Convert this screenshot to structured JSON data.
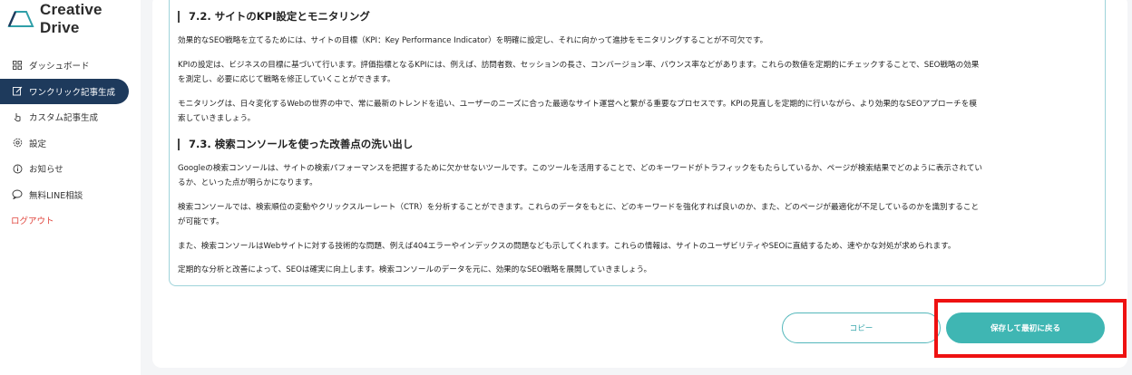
{
  "app": {
    "logo_text": "Creative Drive"
  },
  "sidebar": {
    "items": [
      {
        "label": "ダッシュボード",
        "icon": "grid-icon"
      },
      {
        "label": "ワンクリック記事生成",
        "icon": "edit-icon"
      },
      {
        "label": "カスタム記事生成",
        "icon": "pointer-icon"
      },
      {
        "label": "設定",
        "icon": "gear-icon"
      },
      {
        "label": "お知らせ",
        "icon": "info-icon"
      },
      {
        "label": "無料LINE相談",
        "icon": "chat-icon"
      },
      {
        "label": "ログアウト",
        "icon": ""
      }
    ],
    "active_index": 1
  },
  "article": {
    "section1_title": "7.2. サイトのKPI設定とモニタリング",
    "section1_p1": "効果的なSEO戦略を立てるためには、サイトの目標（KPI：Key Performance Indicator）を明確に設定し、それに向かって進捗をモニタリングすることが不可欠です。",
    "section1_p2_line1": "KPIの設定は、ビジネスの目標に基づいて行います。評価指標となるKPIには、例えば、訪問者数、セッションの長さ、コンバージョン率、バウンス率などがあります。これらの数値を定期的にチェックすることで、SEO戦略の効果",
    "section1_p2_line2": "を測定し、必要に応じて戦略を修正していくことができます。",
    "section1_p3_line1": "モニタリングは、日々変化するWebの世界の中で、常に最新のトレンドを追い、ユーザーのニーズに合った最適なサイト運営へと繋がる重要なプロセスです。KPIの見直しを定期的に行いながら、より効果的なSEOアプローチを模",
    "section1_p3_line2": "索していきましょう。",
    "section2_title": "7.3. 検索コンソールを使った改善点の洗い出し",
    "section2_p1_line1": "Googleの検索コンソールは、サイトの検索パフォーマンスを把握するために欠かせないツールです。このツールを活用することで、どのキーワードがトラフィックをもたらしているか、ページが検索結果でどのように表示されてい",
    "section2_p1_line2": "るか、といった点が明らかになります。",
    "section2_p2_line1": "検索コンソールでは、検索順位の変動やクリックスルーレート（CTR）を分析することができます。これらのデータをもとに、どのキーワードを強化すれば良いのか、また、どのページが最適化が不足しているのかを識別すること",
    "section2_p2_line2": "が可能です。",
    "section2_p3": "また、検索コンソールはWebサイトに対する技術的な問題、例えば404エラーやインデックスの問題なども示してくれます。これらの情報は、サイトのユーザビリティやSEOに直結するため、速やかな対処が求められます。",
    "section2_p4": "定期的な分析と改善によって、SEOは確実に向上します。検索コンソールのデータを元に、効果的なSEO戦略を展開していきましょう。"
  },
  "actions": {
    "copy_label": "コピー",
    "save_label": "保存して最初に戻る"
  },
  "colors": {
    "accent": "#3fb6b3",
    "sidebar_active": "#1e3a5c",
    "logout": "#e0443c",
    "highlight": "#ee1111"
  }
}
